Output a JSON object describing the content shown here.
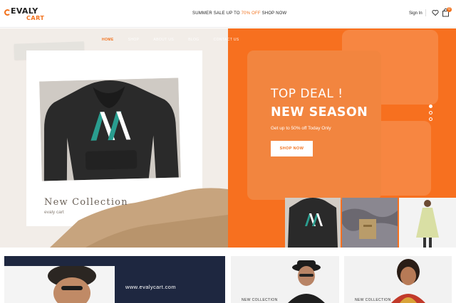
{
  "header": {
    "logo_line1": "EVALY",
    "logo_line2": "CART",
    "promo_prefix": "SUMMER SALE UP TO ",
    "promo_highlight": "70% OFF",
    "promo_link": "SHOP NOW",
    "signin_label": "Sign In",
    "cart_count": "0"
  },
  "nav": {
    "items": [
      {
        "label": "HOME",
        "active": true
      },
      {
        "label": "SHOP",
        "active": false
      },
      {
        "label": "ABOUT US",
        "active": false
      },
      {
        "label": "BLOG",
        "active": false
      },
      {
        "label": "CONTACT US",
        "active": false
      }
    ]
  },
  "hero": {
    "collection_title": "New Collection",
    "collection_sub": "evaly cart",
    "deal_title": "TOP DEAL !",
    "season_title": "NEW SEASON",
    "deal_sub": "Get up to 50% off Today Only",
    "shop_button": "SHOP NOW",
    "slider_dots": 3,
    "active_dot": 0
  },
  "lower": {
    "promo_url": "www.evalycart.com",
    "card1_label": "NEW COLLECTION",
    "card2_label": "NEW COLLECTION"
  },
  "colors": {
    "accent": "#f2711c",
    "hero_orange": "#f7701f",
    "navy": "#1e2740"
  },
  "icons": [
    "heart-icon",
    "bag-icon",
    "hoodie-logo-icon"
  ]
}
